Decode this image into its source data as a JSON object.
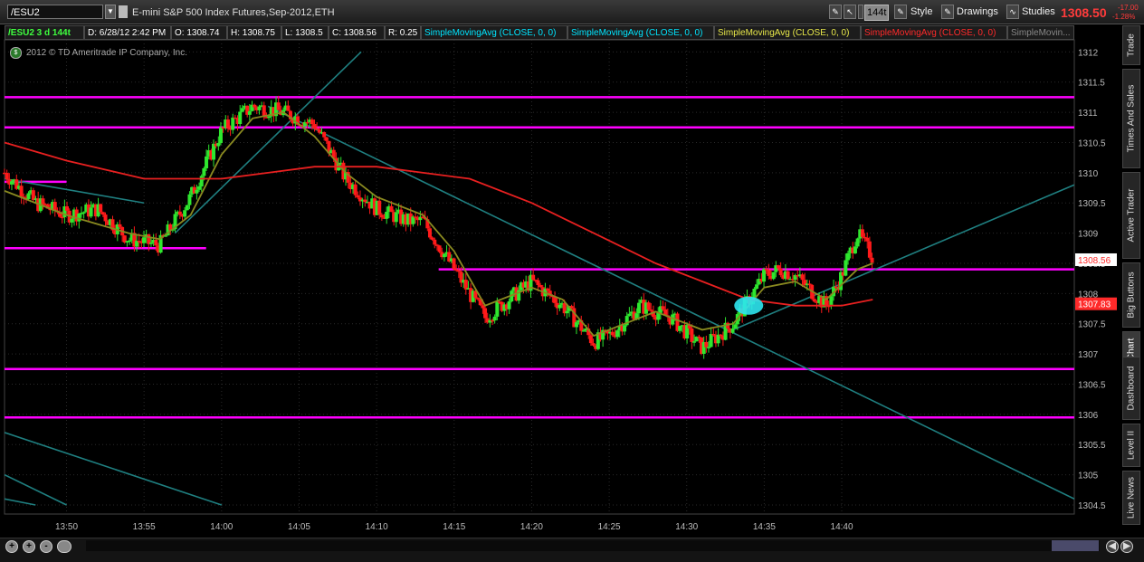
{
  "toolbar": {
    "symbol": "/ESU2",
    "description": "E-mini S&P 500 Index Futures,Sep-2012,ETH",
    "aggregation": "144t",
    "style_label": "Style",
    "drawings_label": "Drawings",
    "studies_label": "Studies",
    "last_price": "1308.50",
    "change": "-17.00",
    "change_pct": "-1.28%"
  },
  "infobar": {
    "symbol_period": "/ESU2 3 d 144t",
    "datetime": "D: 6/28/12 2:42 PM",
    "open": "O: 1308.74",
    "high": "H: 1308.75",
    "low": "L: 1308.5",
    "close": "C: 1308.56",
    "range": "R: 0.25",
    "studies": [
      {
        "label": "SimpleMovingAvg (CLOSE, 0, 0)",
        "color": "#00e5ff"
      },
      {
        "label": "SimpleMovingAvg (CLOSE, 0, 0)",
        "color": "#00e5ff"
      },
      {
        "label": "SimpleMovingAvg (CLOSE, 0, 0)",
        "color": "#e8e84a"
      },
      {
        "label": "SimpleMovingAvg (CLOSE, 0, 0)",
        "color": "#ff2a2a"
      },
      {
        "label": "SimpleMovin...",
        "color": "#888888"
      }
    ]
  },
  "copyright": "2012 © TD Ameritrade IP Company, Inc.",
  "side_tabs": [
    "Trade",
    "Times And Sales",
    "Active Trader",
    "Big Buttons",
    "Chart",
    "Dashboard",
    "Level II",
    "Live News"
  ],
  "chart_data": {
    "type": "candlestick",
    "y_axis": {
      "min": 1304.5,
      "max": 1312,
      "ticks": [
        "1312",
        "1311.5",
        "1311",
        "1310.5",
        "1310",
        "1309.5",
        "1309",
        "1308.5",
        "1308",
        "1307.5",
        "1307",
        "1306.5",
        "1306",
        "1305.5",
        "1305",
        "1304.5"
      ]
    },
    "x_axis": {
      "min": "13:46",
      "max": "14:55",
      "ticks": [
        "13:50",
        "13:55",
        "14:00",
        "14:05",
        "14:10",
        "14:15",
        "14:20",
        "14:25",
        "14:30",
        "14:35",
        "14:40"
      ]
    },
    "price_labels": [
      {
        "value": 1308.56,
        "text": "1308.56",
        "color": "#ff2a2a",
        "bg": "#ffffff"
      },
      {
        "value": 1307.83,
        "text": "1307.83",
        "color": "#ffffff",
        "bg": "#ff2a2a"
      }
    ],
    "close_path": [
      [
        "13:46",
        1310.0
      ],
      [
        "13:48",
        1309.5
      ],
      [
        "13:50",
        1309.3
      ],
      [
        "13:52",
        1309.4
      ],
      [
        "13:54",
        1308.9
      ],
      [
        "13:56",
        1308.8
      ],
      [
        "13:58",
        1309.6
      ],
      [
        "14:00",
        1310.7
      ],
      [
        "14:02",
        1311.1
      ],
      [
        "14:04",
        1311.0
      ],
      [
        "14:06",
        1310.8
      ],
      [
        "14:08",
        1309.9
      ],
      [
        "14:10",
        1309.4
      ],
      [
        "14:12",
        1309.2
      ],
      [
        "14:13",
        1309.2
      ],
      [
        "14:15",
        1308.4
      ],
      [
        "14:17",
        1307.6
      ],
      [
        "14:18",
        1307.8
      ],
      [
        "14:20",
        1308.2
      ],
      [
        "14:22",
        1307.8
      ],
      [
        "14:24",
        1307.2
      ],
      [
        "14:25",
        1307.3
      ],
      [
        "14:27",
        1307.8
      ],
      [
        "14:29",
        1307.6
      ],
      [
        "14:31",
        1307.1
      ],
      [
        "14:33",
        1307.5
      ],
      [
        "14:35",
        1308.3
      ],
      [
        "14:36",
        1308.4
      ],
      [
        "14:37",
        1308.3
      ],
      [
        "14:39",
        1307.8
      ],
      [
        "14:40",
        1308.3
      ],
      [
        "14:41",
        1309.0
      ],
      [
        "14:42",
        1308.6
      ]
    ],
    "moving_averages": [
      {
        "color": "#8a8a20",
        "points": [
          [
            "13:46",
            1309.7
          ],
          [
            "13:50",
            1309.3
          ],
          [
            "13:54",
            1309.0
          ],
          [
            "13:56",
            1308.9
          ],
          [
            "13:58",
            1309.3
          ],
          [
            "14:00",
            1310.3
          ],
          [
            "14:02",
            1310.9
          ],
          [
            "14:04",
            1311.0
          ],
          [
            "14:06",
            1310.6
          ],
          [
            "14:08",
            1310.0
          ],
          [
            "14:10",
            1309.6
          ],
          [
            "14:13",
            1309.3
          ],
          [
            "14:15",
            1308.7
          ],
          [
            "14:17",
            1307.8
          ],
          [
            "14:20",
            1308.1
          ],
          [
            "14:22",
            1307.9
          ],
          [
            "14:24",
            1307.3
          ],
          [
            "14:26",
            1307.5
          ],
          [
            "14:28",
            1307.7
          ],
          [
            "14:31",
            1307.4
          ],
          [
            "14:33",
            1307.5
          ],
          [
            "14:35",
            1308.1
          ],
          [
            "14:37",
            1308.2
          ],
          [
            "14:39",
            1307.9
          ],
          [
            "14:41",
            1308.4
          ],
          [
            "14:42",
            1308.5
          ]
        ]
      },
      {
        "color": "#e82020",
        "points": [
          [
            "13:46",
            1310.5
          ],
          [
            "13:50",
            1310.2
          ],
          [
            "13:55",
            1309.9
          ],
          [
            "14:00",
            1309.9
          ],
          [
            "14:03",
            1310.0
          ],
          [
            "14:06",
            1310.1
          ],
          [
            "14:10",
            1310.1
          ],
          [
            "14:13",
            1310.0
          ],
          [
            "14:16",
            1309.9
          ],
          [
            "14:20",
            1309.5
          ],
          [
            "14:24",
            1309.0
          ],
          [
            "14:28",
            1308.5
          ],
          [
            "14:31",
            1308.2
          ],
          [
            "14:34",
            1307.9
          ],
          [
            "14:37",
            1307.8
          ],
          [
            "14:40",
            1307.8
          ],
          [
            "14:42",
            1307.9
          ]
        ]
      }
    ],
    "horizontal_lines": [
      {
        "y": 1311.25,
        "x_from": "13:46",
        "x_to": "14:55"
      },
      {
        "y": 1310.75,
        "x_from": "13:46",
        "x_to": "14:55"
      },
      {
        "y": 1309.85,
        "x_from": "13:46",
        "x_to": "13:50"
      },
      {
        "y": 1308.75,
        "x_from": "13:46",
        "x_to": "13:59"
      },
      {
        "y": 1308.4,
        "x_from": "14:14",
        "x_to": "14:55"
      },
      {
        "y": 1306.75,
        "x_from": "13:46",
        "x_to": "14:55"
      },
      {
        "y": 1305.95,
        "x_from": "13:46",
        "x_to": "14:55"
      }
    ],
    "trend_lines": [
      {
        "from": [
          "13:46",
          1309.9
        ],
        "to": [
          "13:55",
          1309.5
        ]
      },
      {
        "from": [
          "13:57",
          1309.0
        ],
        "to": [
          "14:09",
          1312.0
        ]
      },
      {
        "from": [
          "14:03",
          1311.1
        ],
        "to": [
          "14:55",
          1304.6
        ]
      },
      {
        "from": [
          "14:33",
          1307.4
        ],
        "to": [
          "14:55",
          1309.8
        ]
      },
      {
        "from": [
          "13:46",
          1305.7
        ],
        "to": [
          "14:00",
          1304.5
        ]
      },
      {
        "from": [
          "13:46",
          1305.0
        ],
        "to": [
          "13:50",
          1304.5
        ]
      },
      {
        "from": [
          "13:46",
          1304.6
        ],
        "to": [
          "13:48",
          1304.5
        ]
      }
    ],
    "highlight": {
      "x": "14:34",
      "y": 1307.8
    }
  }
}
